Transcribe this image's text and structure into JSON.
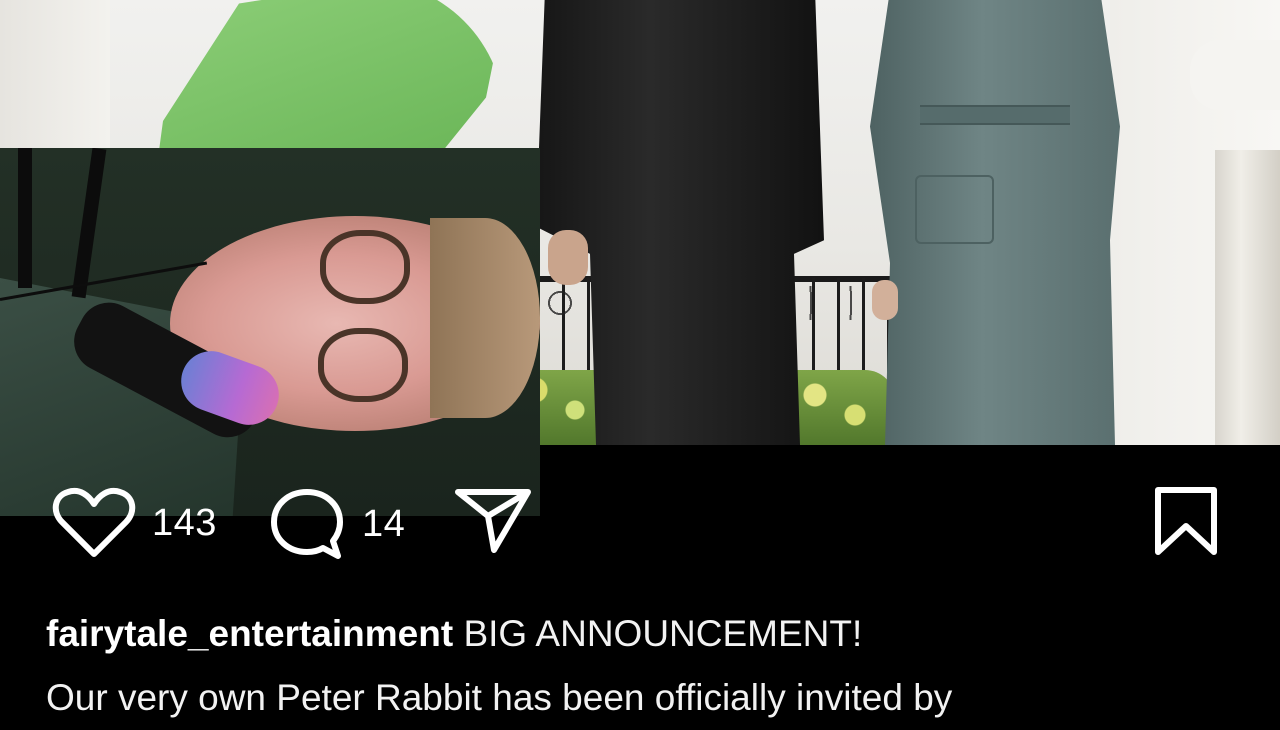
{
  "post": {
    "likes": "143",
    "comments": "14"
  },
  "caption": {
    "username": "fairytale_entertainment",
    "line1": "BIG ANNOUNCEMENT!",
    "line2": "Our very own Peter Rabbit has been officially invited by"
  },
  "icons": {
    "like": "heart-outline-icon",
    "comment": "speech-bubble-icon",
    "share": "paper-plane-icon",
    "save": "bookmark-outline-icon"
  },
  "colors": {
    "background": "#000000",
    "text": "#ffffff"
  }
}
